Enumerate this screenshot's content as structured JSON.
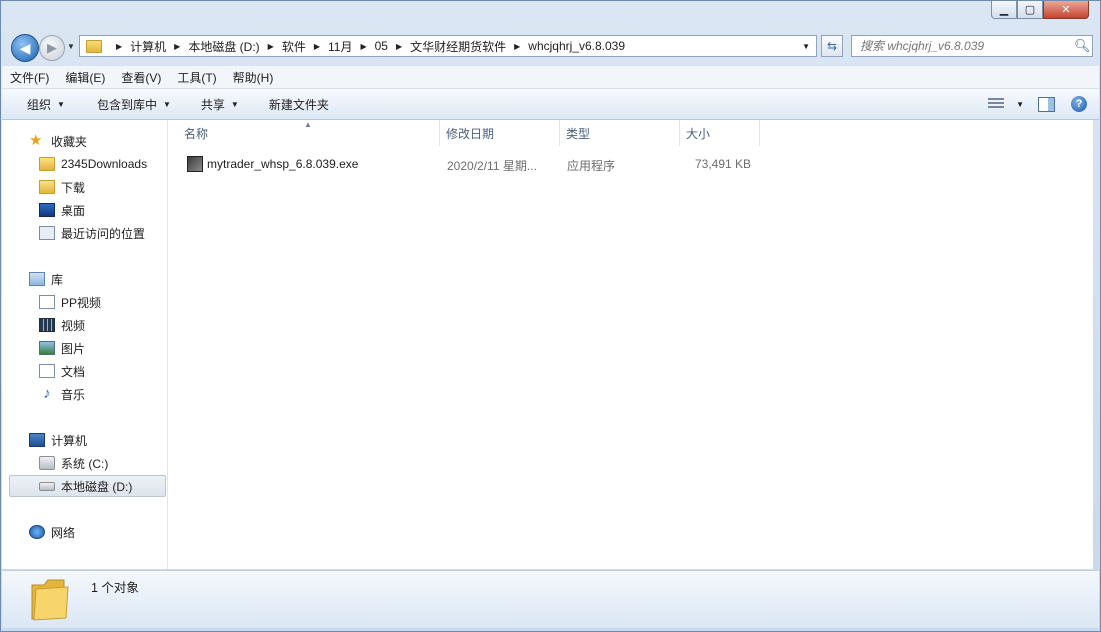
{
  "window": {
    "caption_minimize": "▁",
    "caption_maximize": "▢",
    "caption_close": "✕"
  },
  "address": {
    "crumbs": [
      "计算机",
      "本地磁盘 (D:)",
      "软件",
      "11月",
      "05",
      "文华财经期货软件",
      "whcjqhrj_v6.8.039"
    ]
  },
  "search": {
    "placeholder": "搜索 whcjqhrj_v6.8.039"
  },
  "menu": {
    "file": "文件(F)",
    "edit": "编辑(E)",
    "view": "查看(V)",
    "tools": "工具(T)",
    "help": "帮助(H)"
  },
  "commands": {
    "organize": "组织",
    "include_library": "包含到库中",
    "share": "共享",
    "new_folder": "新建文件夹"
  },
  "sidebar": {
    "favorites": "收藏夹",
    "downloads2345": "2345Downloads",
    "downloads": "下载",
    "desktop": "桌面",
    "recent": "最近访问的位置",
    "libraries": "库",
    "pp_video": "PP视频",
    "videos": "视频",
    "pictures": "图片",
    "documents": "文档",
    "music": "音乐",
    "computer": "计算机",
    "system_c": "系统 (C:)",
    "local_d": "本地磁盘 (D:)",
    "network": "网络"
  },
  "columns": {
    "name": "名称",
    "modified": "修改日期",
    "type": "类型",
    "size": "大小"
  },
  "files": [
    {
      "name": "mytrader_whsp_6.8.039.exe",
      "modified": "2020/2/11 星期...",
      "type": "应用程序",
      "size": "73,491 KB"
    }
  ],
  "status": {
    "count": "1 个对象"
  }
}
